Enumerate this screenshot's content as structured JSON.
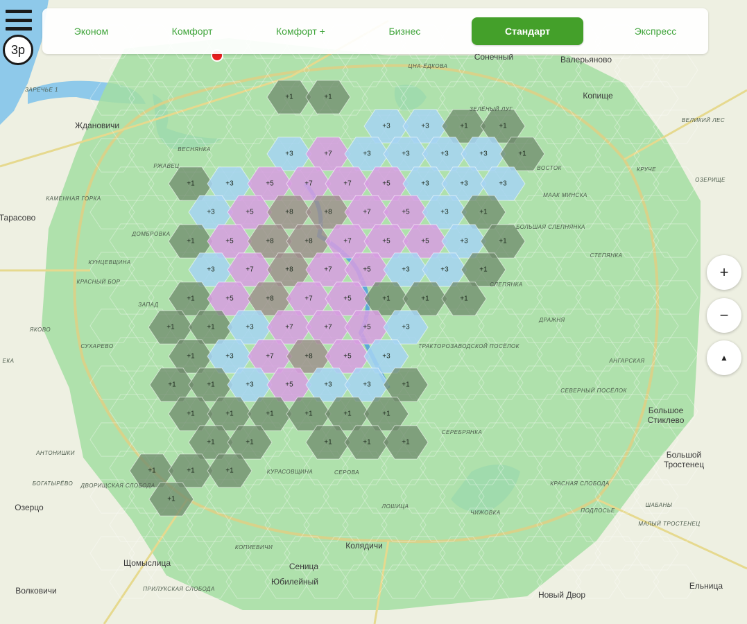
{
  "tariffs": [
    {
      "label": "Эконом",
      "active": false
    },
    {
      "label": "Комфорт",
      "active": false
    },
    {
      "label": "Комфорт +",
      "active": false
    },
    {
      "label": "Бизнес",
      "active": false
    },
    {
      "label": "Стандарт",
      "active": true
    },
    {
      "label": "Экспресс",
      "active": false
    }
  ],
  "price_badge": "3р",
  "controls": {
    "zoom_in": "+",
    "zoom_out": "−",
    "compass": "▲"
  },
  "surge_colors": {
    "1": "#6f8a6c",
    "3": "#a6d3f2",
    "5": "#d79ee0",
    "7": "#d79ee0",
    "8": "#9d8d8c",
    "base": "#9fdca0"
  },
  "hexes": [
    {
      "label": "+1"
    },
    {
      "label": "+1"
    },
    {
      "label": "+3"
    },
    {
      "label": "+3"
    },
    {
      "label": "+1"
    },
    {
      "label": "+1"
    },
    {
      "label": "+3"
    },
    {
      "label": "+7"
    },
    {
      "label": "+3"
    },
    {
      "label": "+3"
    },
    {
      "label": "+3"
    },
    {
      "label": "+3"
    },
    {
      "label": "+1"
    },
    {
      "label": "+1"
    },
    {
      "label": "+3"
    },
    {
      "label": "+5"
    },
    {
      "label": "+7"
    },
    {
      "label": "+7"
    },
    {
      "label": "+5"
    },
    {
      "label": "+3"
    },
    {
      "label": "+3"
    },
    {
      "label": "+3"
    },
    {
      "label": "+3"
    },
    {
      "label": "+5"
    },
    {
      "label": "+8"
    },
    {
      "label": "+8"
    },
    {
      "label": "+7"
    },
    {
      "label": "+5"
    },
    {
      "label": "+3"
    },
    {
      "label": "+1"
    },
    {
      "label": "+1"
    },
    {
      "label": "+5"
    },
    {
      "label": "+8"
    },
    {
      "label": "+8"
    },
    {
      "label": "+7"
    },
    {
      "label": "+5"
    },
    {
      "label": "+5"
    },
    {
      "label": "+3"
    },
    {
      "label": "+1"
    },
    {
      "label": "+3"
    },
    {
      "label": "+7"
    },
    {
      "label": "+8"
    },
    {
      "label": "+7"
    },
    {
      "label": "+5"
    },
    {
      "label": "+3"
    },
    {
      "label": "+3"
    },
    {
      "label": "+1"
    },
    {
      "label": "+1"
    },
    {
      "label": "+5"
    },
    {
      "label": "+8"
    },
    {
      "label": "+7"
    },
    {
      "label": "+5"
    },
    {
      "label": "+1"
    },
    {
      "label": "+1"
    },
    {
      "label": "+1"
    },
    {
      "label": "+1"
    },
    {
      "label": "+1"
    },
    {
      "label": "+3"
    },
    {
      "label": "+7"
    },
    {
      "label": "+7"
    },
    {
      "label": "+5"
    },
    {
      "label": "+3"
    },
    {
      "label": "+1"
    },
    {
      "label": "+3"
    },
    {
      "label": "+7"
    },
    {
      "label": "+8"
    },
    {
      "label": "+5"
    },
    {
      "label": "+3"
    },
    {
      "label": "+1"
    },
    {
      "label": "+1"
    },
    {
      "label": "+3"
    },
    {
      "label": "+5"
    },
    {
      "label": "+3"
    },
    {
      "label": "+3"
    },
    {
      "label": "+1"
    },
    {
      "label": "+1"
    },
    {
      "label": "+1"
    },
    {
      "label": "+1"
    },
    {
      "label": "+1"
    },
    {
      "label": "+1"
    },
    {
      "label": "+1"
    },
    {
      "label": "+1"
    },
    {
      "label": "+1"
    },
    {
      "label": "+1"
    },
    {
      "label": "+1"
    },
    {
      "label": "+1"
    },
    {
      "label": "+1"
    },
    {
      "label": "+1"
    },
    {
      "label": "+1"
    },
    {
      "label": "+1"
    }
  ],
  "places": [
    {
      "name": "Ждановичи",
      "kind": "big"
    },
    {
      "name": "Тарасово",
      "kind": "big"
    },
    {
      "name": "Сонечный",
      "kind": "big"
    },
    {
      "name": "Валерьяново",
      "kind": "big"
    },
    {
      "name": "Копище",
      "kind": "big"
    },
    {
      "name": "Большое Стиклево",
      "kind": "big"
    },
    {
      "name": "Большой Тростенец",
      "kind": "big"
    },
    {
      "name": "Озерцо",
      "kind": "big"
    },
    {
      "name": "Щомыслица",
      "kind": "big"
    },
    {
      "name": "Волковичи",
      "kind": "big"
    },
    {
      "name": "Колядичи",
      "kind": "big"
    },
    {
      "name": "Сеница",
      "kind": "big"
    },
    {
      "name": "Юбилейный",
      "kind": "big"
    },
    {
      "name": "Новый Двор",
      "kind": "big"
    },
    {
      "name": "Ельница",
      "kind": "big"
    },
    {
      "name": "ЗАРЕЧЬЕ 1",
      "kind": "small"
    },
    {
      "name": "КАМЕННАЯ ГОРКА",
      "kind": "small"
    },
    {
      "name": "ДОМБРОВКА",
      "kind": "small"
    },
    {
      "name": "КУНЦЕВЩИНА",
      "kind": "small"
    },
    {
      "name": "КРАСНЫЙ БОР",
      "kind": "small"
    },
    {
      "name": "ЗАПАД",
      "kind": "small"
    },
    {
      "name": "СУХАРЕВО",
      "kind": "small"
    },
    {
      "name": "АНТОНИШКИ",
      "kind": "small"
    },
    {
      "name": "БОГАТЫРЁВО",
      "kind": "small"
    },
    {
      "name": "ДВОРИЩСКАЯ СЛОБОДА",
      "kind": "small"
    },
    {
      "name": "КУРАСОВЩИНА",
      "kind": "small"
    },
    {
      "name": "СЕРОВА",
      "kind": "small"
    },
    {
      "name": "ЛОШИЦА",
      "kind": "small"
    },
    {
      "name": "ЧИЖОВКА",
      "kind": "small"
    },
    {
      "name": "КРАСНАЯ СЛОБОДА",
      "kind": "small"
    },
    {
      "name": "ТРАКТОРОЗАВОДСКОЙ ПОСЁЛОК",
      "kind": "small"
    },
    {
      "name": "АНГАРСКАЯ",
      "kind": "small"
    },
    {
      "name": "СЕВЕРНЫЙ ПОСЁЛОК",
      "kind": "small"
    },
    {
      "name": "СЕРЕБРЯНКА",
      "kind": "small"
    },
    {
      "name": "СТЕПЯНКА",
      "kind": "small"
    },
    {
      "name": "БОЛЬШАЯ СЛЕПНЯНКА",
      "kind": "small"
    },
    {
      "name": "МААК МИНСКА",
      "kind": "small"
    },
    {
      "name": "ВОСТОК",
      "kind": "small"
    },
    {
      "name": "ЗЕЛЁНЫЙ ЛУГ",
      "kind": "small"
    },
    {
      "name": "ЦНА-ЁДКОВА",
      "kind": "small"
    },
    {
      "name": "ВЕЛИКИЙ ЛЕС",
      "kind": "small"
    },
    {
      "name": "КРУЧЕ",
      "kind": "small"
    },
    {
      "name": "ОЗЕРИЩЕ",
      "kind": "small"
    },
    {
      "name": "ВЕСНЯНКА",
      "kind": "small"
    },
    {
      "name": "РЖАВЕЦ",
      "kind": "small"
    },
    {
      "name": "ДРАЖНЯ",
      "kind": "small"
    },
    {
      "name": "СЛЕПЯНКА",
      "kind": "small"
    },
    {
      "name": "КОПИЕВИЧИ",
      "kind": "small"
    },
    {
      "name": "ПРИЛУКСКАЯ СЛОБОДА",
      "kind": "small"
    },
    {
      "name": "ПОДЛОСЬЕ",
      "kind": "small"
    },
    {
      "name": "ШАБАНЫ",
      "kind": "small"
    },
    {
      "name": "МАЛЫЙ ТРОСТЕНЕЦ",
      "kind": "small"
    },
    {
      "name": "ЕКА",
      "kind": "small"
    },
    {
      "name": "ЯКОВО",
      "kind": "small"
    }
  ]
}
